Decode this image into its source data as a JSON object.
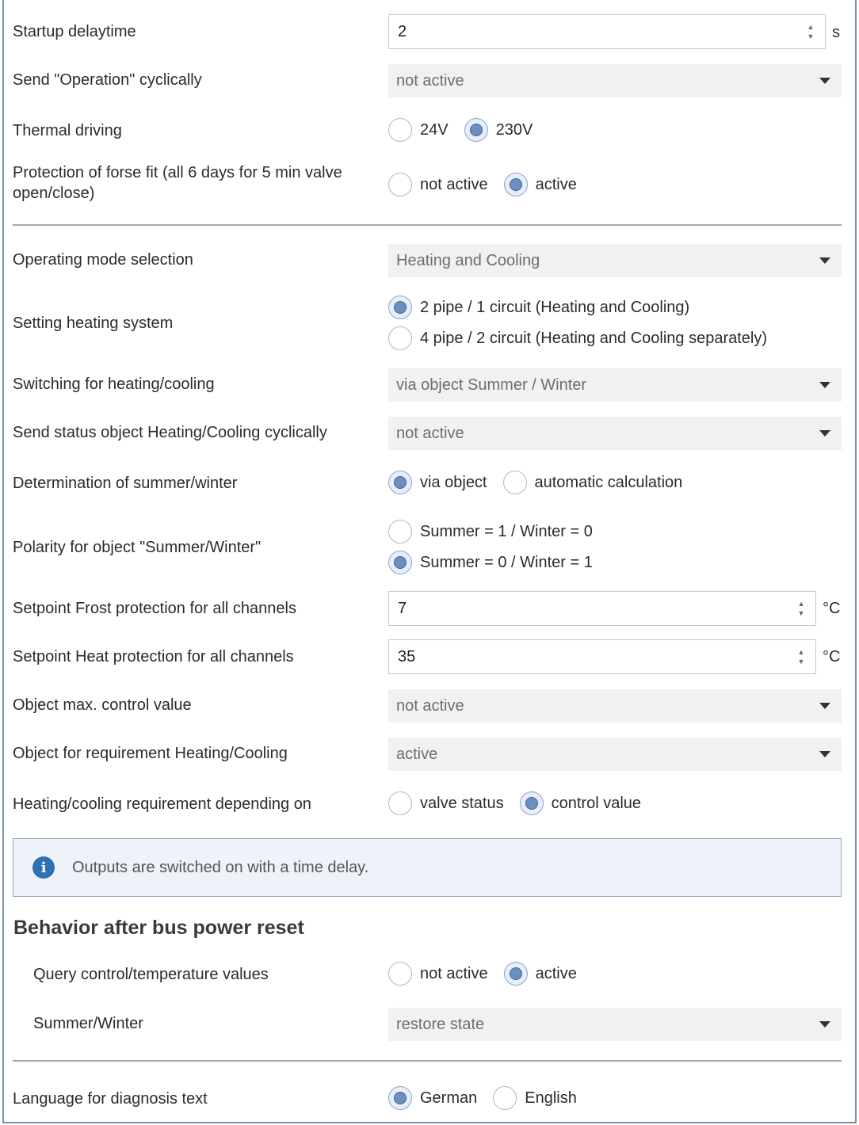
{
  "startup": {
    "label": "Startup delaytime",
    "value": "2",
    "unit": "s"
  },
  "send_operation": {
    "label": "Send \"Operation\" cyclically",
    "value": "not active"
  },
  "thermal_driving": {
    "label": "Thermal driving",
    "options": [
      "24V",
      "230V"
    ],
    "selected": "230V"
  },
  "forse_fit": {
    "label_line1": "Protection of forse fit (all 6 days for 5 min valve",
    "label_line2": "open/close)",
    "options": [
      "not active",
      "active"
    ],
    "selected": "active"
  },
  "operating_mode": {
    "label": "Operating mode selection",
    "value": "Heating and Cooling"
  },
  "heating_system": {
    "label": "Setting heating system",
    "options": [
      "2 pipe / 1 circuit (Heating and Cooling)",
      "4 pipe / 2 circuit (Heating and Cooling separately)"
    ],
    "selected": "2 pipe / 1 circuit (Heating and Cooling)"
  },
  "switching": {
    "label": "Switching for heating/cooling",
    "value": "via object Summer / Winter"
  },
  "send_status": {
    "label": "Send status object Heating/Cooling cyclically",
    "value": "not active"
  },
  "determination": {
    "label": "Determination of summer/winter",
    "options": [
      "via object",
      "automatic calculation"
    ],
    "selected": "via object"
  },
  "polarity": {
    "label": "Polarity for object \"Summer/Winter\"",
    "options": [
      "Summer = 1 / Winter = 0",
      "Summer = 0 / Winter = 1"
    ],
    "selected": "Summer = 0 / Winter = 1"
  },
  "frost": {
    "label": "Setpoint Frost protection for all channels",
    "value": "7",
    "unit": "°C"
  },
  "heat": {
    "label": "Setpoint Heat protection for all channels",
    "value": "35",
    "unit": "°C"
  },
  "max_control": {
    "label": "Object max. control value",
    "value": "not active"
  },
  "requirement": {
    "label": "Object for requirement Heating/Cooling",
    "value": "active"
  },
  "depending": {
    "label": "Heating/cooling requirement depending on",
    "options": [
      "valve status",
      "control value"
    ],
    "selected": "control value"
  },
  "info": {
    "text": "Outputs are switched on with a time delay."
  },
  "bus_reset": {
    "title": "Behavior after bus power reset"
  },
  "query": {
    "label": "Query control/temperature values",
    "options": [
      "not active",
      "active"
    ],
    "selected": "active"
  },
  "summer_winter": {
    "label": "Summer/Winter",
    "value": "restore state"
  },
  "language": {
    "label": "Language for diagnosis text",
    "options": [
      "German",
      "English"
    ],
    "selected": "German"
  },
  "colors": {
    "accent": "#6d8fbd",
    "info_icon": "#2f6fb6",
    "info_bg": "#edf3f9",
    "frame": "#7a8fa6"
  }
}
